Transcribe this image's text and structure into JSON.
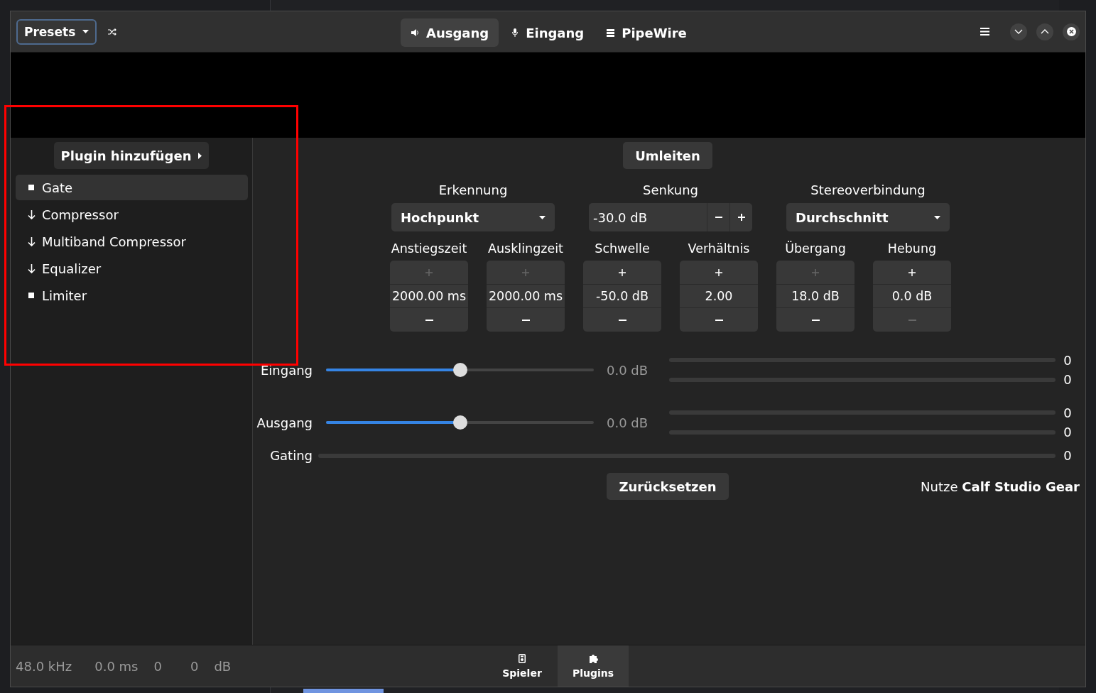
{
  "header": {
    "presets": "Presets",
    "views": [
      {
        "label": "Ausgang",
        "kind": "speaker",
        "selected": true
      },
      {
        "label": "Eingang",
        "kind": "mic",
        "selected": false
      },
      {
        "label": "PipeWire",
        "kind": "server",
        "selected": false
      }
    ]
  },
  "sidebar": {
    "add_button": "Plugin hinzufügen",
    "plugins": [
      {
        "name": "Gate",
        "kind": "fixed",
        "selected": true
      },
      {
        "name": "Compressor",
        "kind": "movable",
        "selected": false
      },
      {
        "name": "Multiband Compressor",
        "kind": "movable",
        "selected": false
      },
      {
        "name": "Equalizer",
        "kind": "movable",
        "selected": false
      },
      {
        "name": "Limiter",
        "kind": "fixed",
        "selected": false
      }
    ]
  },
  "gate": {
    "bypass": "Umleiten",
    "selectors": [
      {
        "label": "Erkennung",
        "kind": "combo",
        "value": "Hochpunkt"
      },
      {
        "label": "Senkung",
        "kind": "spin",
        "value": "-30.0 dB"
      },
      {
        "label": "Stereoverbindung",
        "kind": "combo",
        "value": "Durchschnitt"
      }
    ],
    "spinners": [
      {
        "label": "Anstiegszeit",
        "value": "2000.00 ms",
        "plus_disabled": true,
        "minus_disabled": false
      },
      {
        "label": "Ausklingzeit",
        "value": "2000.00 ms",
        "plus_disabled": true,
        "minus_disabled": false
      },
      {
        "label": "Schwelle",
        "value": "-50.0 dB",
        "plus_disabled": false,
        "minus_disabled": false
      },
      {
        "label": "Verhältnis",
        "value": "2.00",
        "plus_disabled": false,
        "minus_disabled": false
      },
      {
        "label": "Übergang",
        "value": "18.0 dB",
        "plus_disabled": true,
        "minus_disabled": false
      },
      {
        "label": "Hebung",
        "value": "0.0 dB",
        "plus_disabled": false,
        "minus_disabled": true
      }
    ],
    "levels": [
      {
        "label": "Eingang",
        "kind": "slider",
        "level": 0.5,
        "reading": "0.0 dB",
        "meters": [
          {
            "value": "0"
          },
          {
            "value": "0"
          }
        ]
      },
      {
        "label": "Ausgang",
        "kind": "slider",
        "level": 0.5,
        "reading": "0.0 dB",
        "meters": [
          {
            "value": "0"
          },
          {
            "value": "0"
          }
        ]
      },
      {
        "label": "Gating",
        "kind": "meter",
        "meters": [
          {
            "value": "0"
          }
        ]
      }
    ],
    "reset": "Zurücksetzen",
    "credit": "Nutze **Calf Studio Gear**"
  },
  "status_bar": {
    "items": [
      "48.0 kHz",
      "0.0 ms",
      "0",
      "0",
      "dB"
    ],
    "tabs": [
      {
        "label": "Spieler",
        "kind": "player",
        "selected": false
      },
      {
        "label": "Plugins",
        "kind": "plugin",
        "selected": true
      }
    ]
  },
  "annotations": [
    {
      "kind": "rectangle"
    }
  ]
}
